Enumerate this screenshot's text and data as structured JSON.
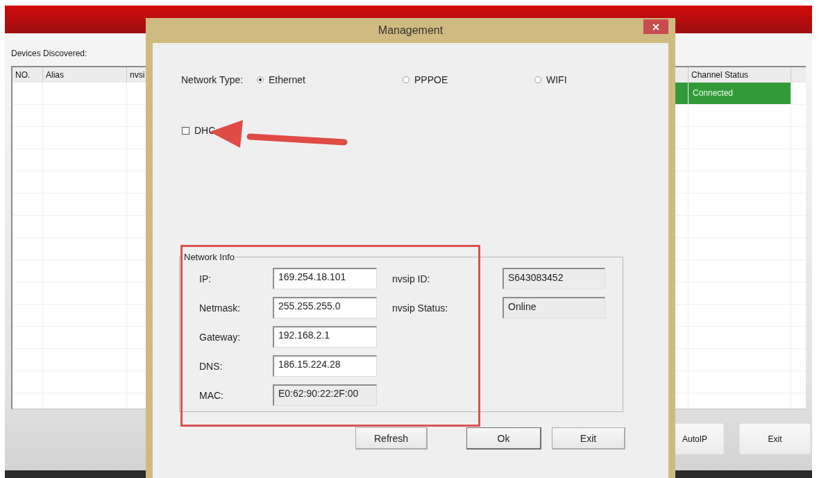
{
  "background_window": {
    "list_label": "Devices Discovered:",
    "table": {
      "columns": [
        "NO.",
        "Alias",
        "nvsi"
      ],
      "right_columns": [
        "Channel Status"
      ],
      "rows": [
        {
          "channel_status": "Connected",
          "color": "#339a3a"
        }
      ]
    },
    "buttons": [
      "AutoIP",
      "Exit"
    ]
  },
  "dialog": {
    "title": "Management",
    "network_type": {
      "label": "Network Type:",
      "options": [
        {
          "label": "Ethernet",
          "selected": true
        },
        {
          "label": "PPPOE",
          "selected": false
        },
        {
          "label": "WIFI",
          "selected": false
        }
      ]
    },
    "dhcp": {
      "label": "DHC",
      "checked": false,
      "arrow_annotation": true
    },
    "network_info": {
      "title": "Network Info",
      "highlighted": true,
      "fields": [
        {
          "label": "IP:",
          "value": "169.254.18.101",
          "readonly": false
        },
        {
          "label": "Netmask:",
          "value": "255.255.255.0",
          "readonly": false
        },
        {
          "label": "Gateway:",
          "value": "192.168.2.1",
          "readonly": false
        },
        {
          "label": "DNS:",
          "value": "186.15.224.28",
          "readonly": false
        },
        {
          "label": "MAC:",
          "value": "E0:62:90:22:2F:00",
          "readonly": true
        }
      ],
      "nvsip": [
        {
          "label": "nvsip ID:",
          "value": "S643083452"
        },
        {
          "label": "nvsip Status:",
          "value": "Online"
        }
      ]
    },
    "buttons": [
      {
        "label": "Refresh",
        "default": false
      },
      {
        "label": "Ok",
        "default": true
      },
      {
        "label": "Exit",
        "default": false
      }
    ]
  }
}
